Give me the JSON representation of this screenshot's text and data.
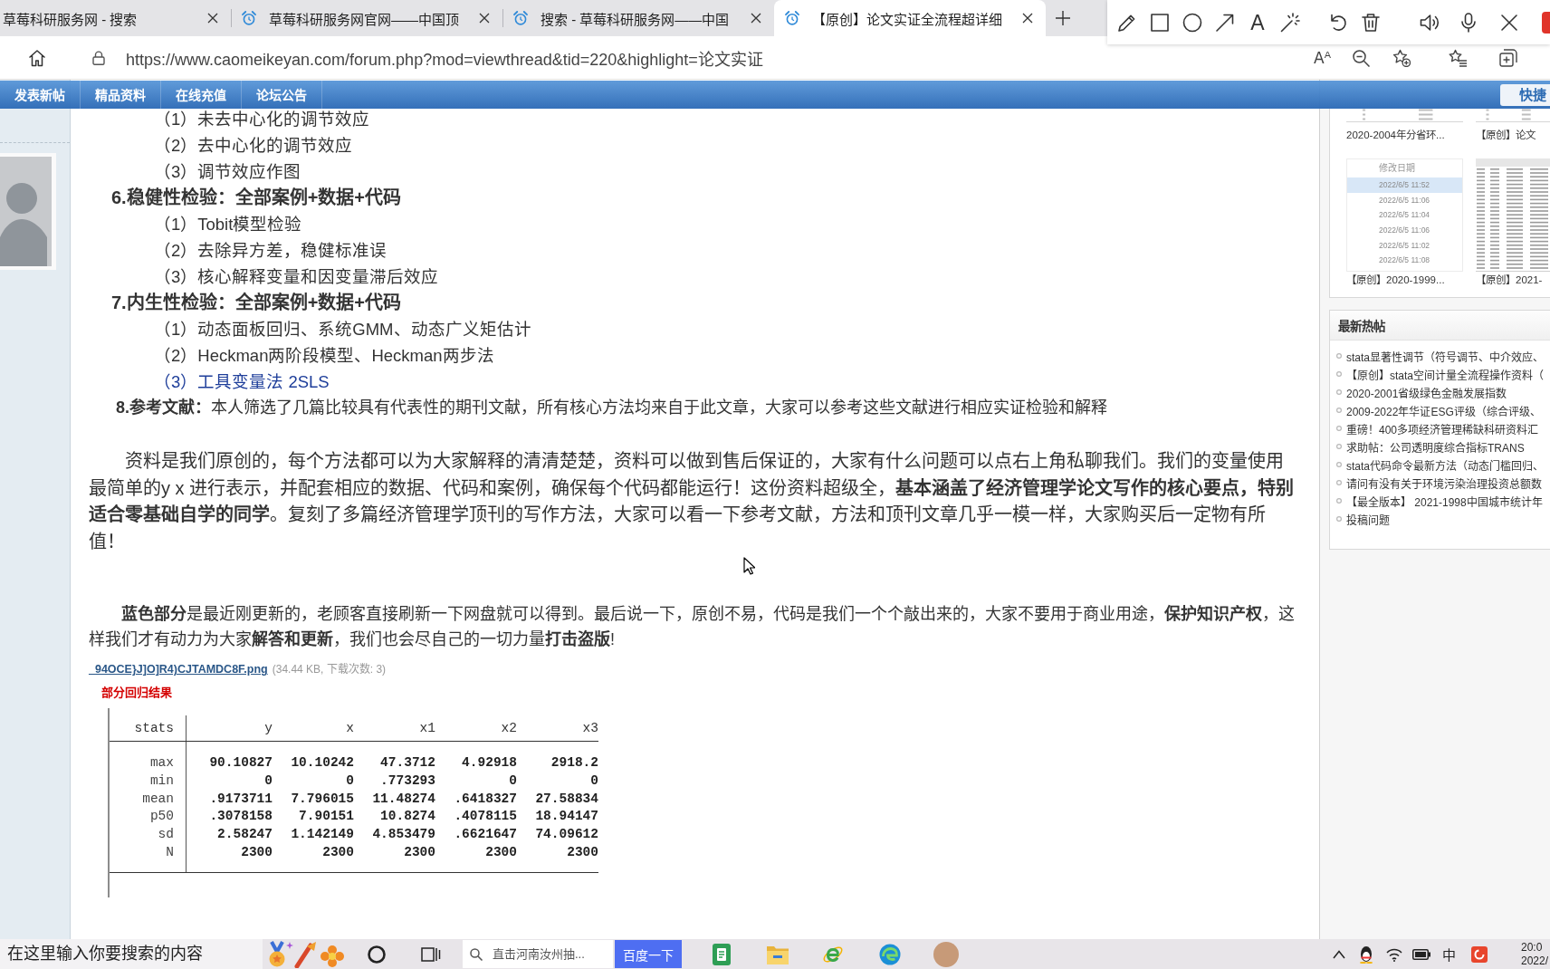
{
  "browser": {
    "tabs": [
      {
        "title": "草莓科研服务网 - 搜索",
        "favicon": false,
        "selected": false
      },
      {
        "title": "草莓科研服务网官网——中国顶",
        "favicon": true,
        "selected": false
      },
      {
        "title": "搜索 - 草莓科研服务网——中国",
        "favicon": true,
        "selected": false
      },
      {
        "title": "【原创】论文实证全流程超详细",
        "favicon": true,
        "selected": true
      }
    ],
    "address_bar": {
      "url": "https://www.caomeikeyan.com/forum.php?mod=viewthread&tid=220&highlight=论文实证",
      "read_aloud": "Aᴬ"
    }
  },
  "annotation_toolbar": {
    "text_tool": "A"
  },
  "forum_nav": {
    "items": [
      "发表新帖",
      "精品资料",
      "在线充值",
      "论坛公告"
    ],
    "quick_nav": "快捷"
  },
  "post": {
    "outline": [
      {
        "children": [
          {
            "text": "（1）未去中心化的调节效应",
            "updated": false
          },
          {
            "text": "（2）去中心化的调节效应",
            "updated": false
          },
          {
            "text": "（3）调节效应作图",
            "updated": false
          }
        ]
      },
      {
        "heading": "6.稳健性检验：全部案例+数据+代码",
        "children": [
          {
            "text": "（1）Tobit模型检验",
            "updated": false
          },
          {
            "text": "（2）去除异方差，稳健标准误",
            "updated": false
          },
          {
            "text": "（3）核心解释变量和因变量滞后效应",
            "updated": false
          }
        ]
      },
      {
        "heading": "7.内生性检验：全部案例+数据+代码",
        "children": [
          {
            "text": "（1）动态面板回归、系统GMM、动态广义矩估计",
            "updated": false
          },
          {
            "text": "（2）Heckman两阶段模型、Heckman两步法",
            "updated": false
          },
          {
            "text": "（3）工具变量法 2SLS",
            "updated": true
          }
        ]
      }
    ],
    "references": "**8.参考文献：**本人筛选了几篇比较具有代表性的期刊文献，所有核心方法均来自于此文章，大家可以参考这些文献进行相应实证检验和解释",
    "paragraphs": [
      "资料是我们原创的，每个方法都可以为大家解释的清清楚楚，资料可以做到售后保证的，大家有什么问题可以点右上角私聊我们。我们的变量使用最简单的y x 进行表示，并配套相应的数据、代码和案例，确保每个代码都能运行！这份资料超级全，**基本涵盖了经济管理学论文写作的核心要点，特别适合零基础自学的同学**。复刻了多篇经济管理学顶刊的写作方法，大家可以看一下参考文献，方法和顶刊文章几乎一模一样，大家购买后一定物有所值！",
      "**蓝色部分**是最近刚更新的，老顾客直接刷新一下网盘就可以得到。最后说一下，原创不易，代码是我们一个个敲出来的，大家不要用于商业用途，**保护知识产权**，这样我们才有动力为大家**解答和更新**，我们也会尽自己的一切力量**打击盗版**!"
    ],
    "attachment": {
      "filename": "_94OCE}J]O]R4)CJTAMDC8F.png",
      "meta": "(34.44 KB, 下载次数: 3)"
    },
    "image": {
      "caption": "部分回归结果",
      "table": {
        "columns": [
          "stats",
          "y",
          "x",
          "x1",
          "x2",
          "x3"
        ],
        "rows": [
          [
            "max",
            "90.10827",
            "10.10242",
            "47.3712",
            "4.92918",
            "2918.2"
          ],
          [
            "min",
            "0",
            "0",
            ".773293",
            "0",
            "0"
          ],
          [
            "mean",
            ".9173711",
            "7.796015",
            "11.48274",
            ".6418327",
            "27.58834"
          ],
          [
            "p50",
            ".3078158",
            "7.90151",
            "10.8274",
            ".4078115",
            "18.94147"
          ],
          [
            "sd",
            "2.58247",
            "1.142149",
            "4.853479",
            ".6621647",
            "74.09612"
          ],
          [
            "N",
            "2300",
            "2300",
            "2300",
            "2300",
            "2300"
          ]
        ]
      }
    }
  },
  "sidebar": {
    "thumbnails": [
      {
        "kind": "table",
        "caption": "2020-2004年分省环..."
      },
      {
        "kind": "table",
        "caption": "【原创】论文"
      },
      {
        "kind": "file-list",
        "caption": "【原创】2020-1999...",
        "file_list": {
          "header": "修改日期",
          "rows": [
            {
              "text": "2022/6/5 11:52",
              "selected": true
            },
            {
              "text": "2022/6/5 11:06",
              "selected": false
            },
            {
              "text": "2022/6/5 11:04",
              "selected": false
            },
            {
              "text": "2022/6/5 11:06",
              "selected": false
            },
            {
              "text": "2022/6/5 11:02",
              "selected": false
            },
            {
              "text": "2022/6/5 11:08",
              "selected": false
            }
          ]
        }
      },
      {
        "kind": "spreadsheet",
        "caption": "【原创】2021-"
      }
    ],
    "hot_posts": {
      "title": "最新热帖",
      "items": [
        "stata显著性调节（符号调节、中介效应、",
        "【原创】stata空间计量全流程操作资料（",
        "2020-2001省级绿色金融发展指数",
        "2009-2022年华证ESG评级（综合评级、",
        "重磅！400多项经济管理稀缺科研资料汇",
        "求助帖：公司透明度综合指标TRANS",
        "stata代码命令最新方法（动态门槛回归、",
        "请问有没有关于环境污染治理投资总额数",
        "【最全版本】 2021-1998中国城市统计年",
        "投稿问题"
      ]
    }
  },
  "taskbar": {
    "search": {
      "placeholder": "在这里输入你要搜索的内容"
    },
    "news_search": {
      "placeholder": "直击河南汝州抽...",
      "button": "百度一下"
    },
    "ime": "中",
    "time": "20:0",
    "date": "2022/"
  }
}
